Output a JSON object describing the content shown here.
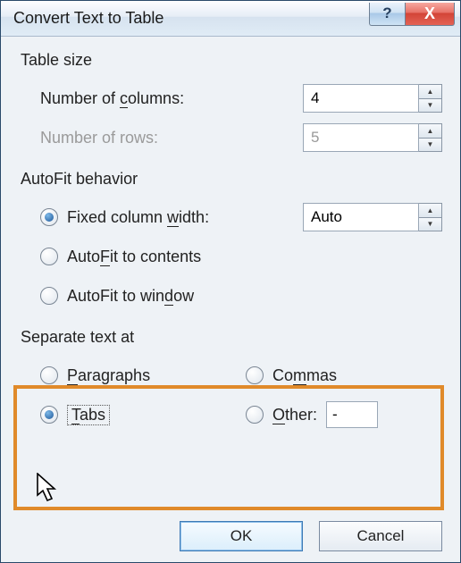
{
  "title": "Convert Text to Table",
  "help_glyph": "?",
  "close_glyph": "X",
  "table_size": {
    "heading": "Table size",
    "columns_label_pre": "Number of ",
    "columns_label_u": "c",
    "columns_label_post": "olumns:",
    "columns_value": "4",
    "rows_label": "Number of rows:",
    "rows_value": "5"
  },
  "autofit": {
    "heading": "AutoFit behavior",
    "fixed_pre": "Fixed column ",
    "fixed_u": "w",
    "fixed_post": "idth:",
    "fixed_value": "Auto",
    "contents_pre": "Auto",
    "contents_u": "F",
    "contents_post": "it to contents",
    "window_pre": "AutoFit to win",
    "window_u": "d",
    "window_post": "ow"
  },
  "separate": {
    "heading": "Separate text at",
    "paragraphs_u": "P",
    "paragraphs_post": "aragraphs",
    "commas_pre": "Co",
    "commas_u": "m",
    "commas_post": "mas",
    "tabs_u": "T",
    "tabs_post": "abs",
    "other_u": "O",
    "other_post": "ther:",
    "other_value": "-"
  },
  "buttons": {
    "ok": "OK",
    "cancel": "Cancel"
  }
}
